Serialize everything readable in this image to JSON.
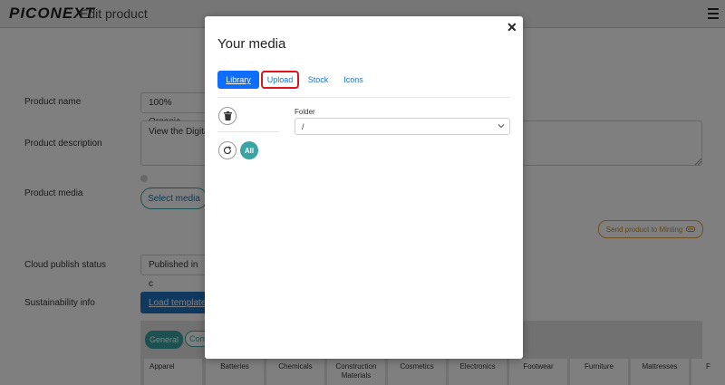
{
  "header": {
    "logo": "PICONEXT",
    "title": "Edit product"
  },
  "form": {
    "product_name_label": "Product name",
    "product_name_value": "100% Organic",
    "product_description_label": "Product description",
    "product_description_value": "View the Digita",
    "product_media_label": "Product media",
    "select_media_label": "Select media",
    "send_to_minting_label": "Send product to Minting",
    "cloud_publish_label": "Cloud publish status",
    "cloud_publish_value": "Published in c",
    "sustainability_label": "Sustainability info",
    "load_template_label": "Load template",
    "tabs": {
      "general": "General",
      "com": "Com"
    },
    "categories": [
      "Apparel",
      "Batteries",
      "Chemicals",
      "Construction Materials",
      "Cosmetics",
      "Electronics",
      "Footwear",
      "Furniture",
      "Mattresses",
      "F"
    ]
  },
  "modal": {
    "title": "Your media",
    "tabs": {
      "library": "Library",
      "upload": "Upload",
      "stock": "Stock",
      "icons": "Icons"
    },
    "folder_label": "Folder",
    "folder_value": "/",
    "all_label": "All"
  },
  "colors": {
    "primary": "#0d6efd",
    "teal": "#3aa3a3",
    "highlight": "#e0141b",
    "mint_accent": "#e0a040"
  }
}
